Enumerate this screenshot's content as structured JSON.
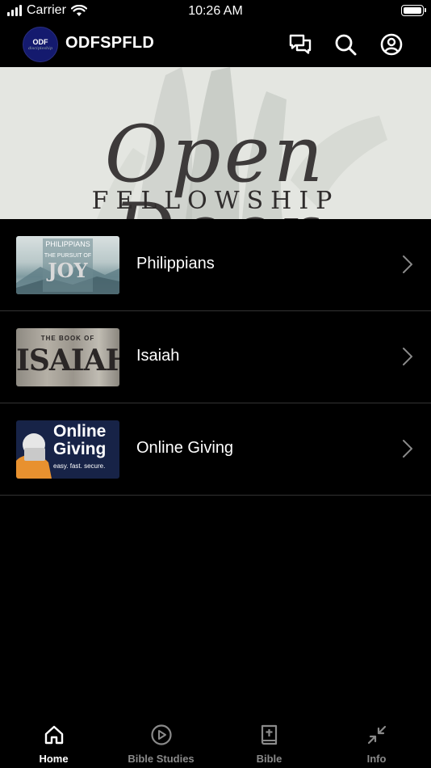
{
  "status_bar": {
    "carrier": "Carrier",
    "time": "10:26 AM"
  },
  "header": {
    "logo_text": "ODF",
    "logo_subtext": "discipleship",
    "title": "ODFSPFLD",
    "icons": [
      "chat-icon",
      "search-icon",
      "profile-icon"
    ]
  },
  "banner": {
    "script_text": "Open Door",
    "subtitle": "FELLOWSHIP"
  },
  "list": {
    "items": [
      {
        "label": "Philippians",
        "thumb_lines": [
          "PHILIPPIANS",
          "THE PURSUIT OF",
          "JOY"
        ]
      },
      {
        "label": "Isaiah",
        "thumb_lines": [
          "THE BOOK OF",
          "ISAIAH"
        ]
      },
      {
        "label": "Online Giving",
        "thumb_lines": [
          "Online",
          "Giving",
          "easy. fast. secure."
        ]
      }
    ]
  },
  "tabs": [
    {
      "label": "Home",
      "icon": "home-icon",
      "active": true
    },
    {
      "label": "Bible Studies",
      "icon": "play-icon",
      "active": false
    },
    {
      "label": "Bible",
      "icon": "bible-icon",
      "active": false
    },
    {
      "label": "Info",
      "icon": "collapse-icon",
      "active": false
    }
  ],
  "colors": {
    "background": "#000000",
    "divider": "#333333",
    "tab_inactive": "#8a8a8a",
    "logo_bg": "#141a6e",
    "banner_bg": "#e4e6e1"
  }
}
